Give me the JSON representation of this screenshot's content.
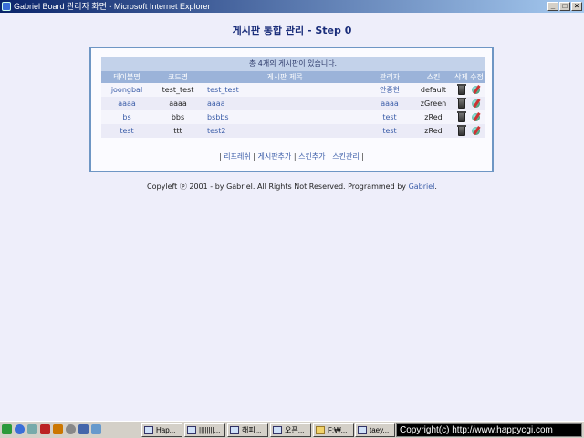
{
  "window": {
    "title": "Gabriel Board 관리자 화면 - Microsoft Internet Explorer",
    "min": "_",
    "max": "□",
    "close": "×"
  },
  "page": {
    "heading": "게시판 통합 관리 - Step 0"
  },
  "summary": "총 4개의 게시판이 있습니다.",
  "columns": [
    "테이블명",
    "코드명",
    "게시판 제목",
    "관리자",
    "스킨",
    "삭제",
    "수정"
  ],
  "rows": [
    {
      "table": "joongbal",
      "code": "test_test",
      "title": "test_test",
      "admin": "안중현",
      "skin": "default"
    },
    {
      "table": "aaaa",
      "code": "aaaa",
      "title": "aaaa",
      "admin": "aaaa",
      "skin": "zGreen"
    },
    {
      "table": "bs",
      "code": "bbs",
      "title": "bsbbs",
      "admin": "test",
      "skin": "zRed"
    },
    {
      "table": "test",
      "code": "ttt",
      "title": "test2",
      "admin": "test",
      "skin": "zRed"
    }
  ],
  "menu": {
    "refresh": "리프레쉬",
    "add_board": "게시판추가",
    "add_skin": "스킨추가",
    "manage_skin": "스킨관리"
  },
  "footer": {
    "text": "Copyleft ⓟ 2001 - by Gabriel. All Rights Not Reserved. Programmed by ",
    "author": "Gabriel",
    "end": "."
  },
  "taskbar": {
    "buttons": [
      "Hap...",
      "||||||||...",
      "해피...",
      "오픈...",
      "F:₩...",
      "taey..."
    ],
    "tray": "Copyright(c) http://www.happycgi.com"
  }
}
